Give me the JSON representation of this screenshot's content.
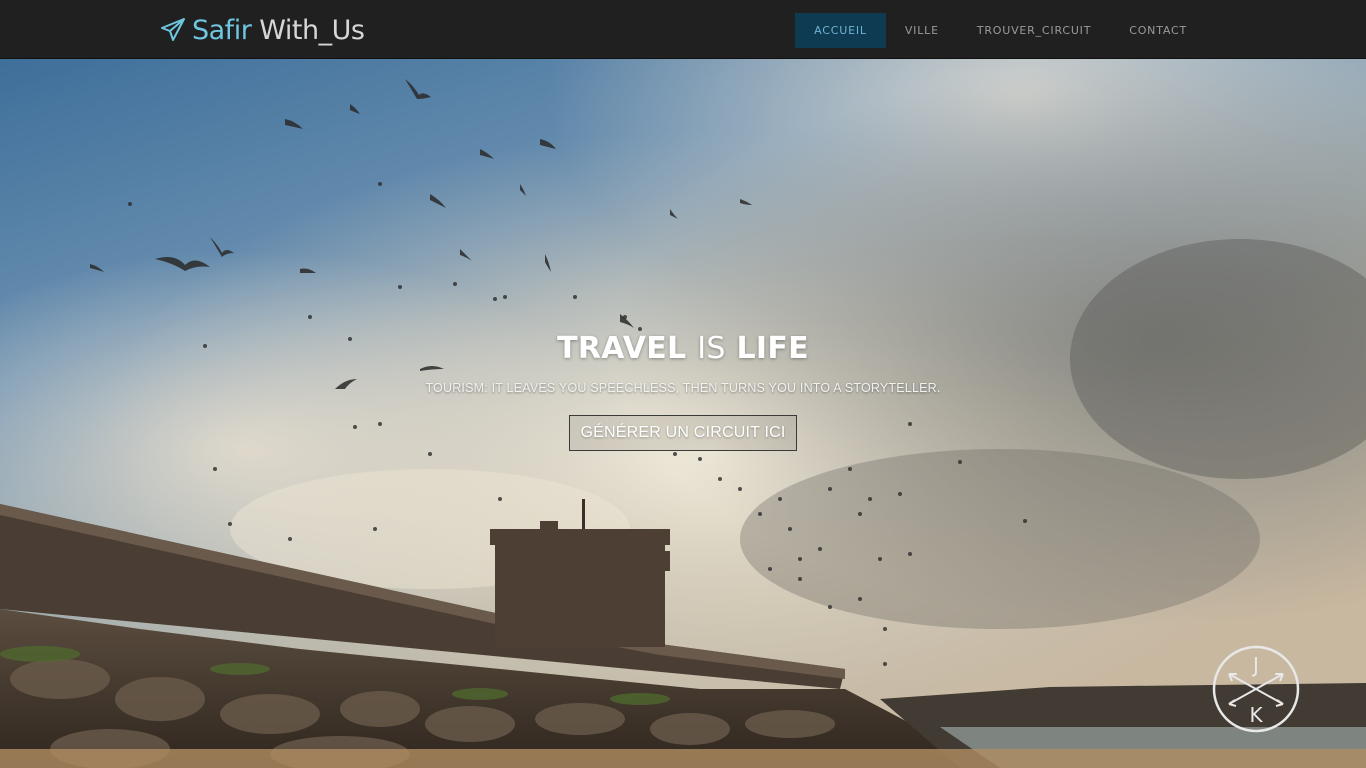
{
  "navbar": {
    "brand": {
      "part1": "Safir",
      "part2": "With_Us",
      "icon": "paper-plane-icon"
    },
    "links": [
      {
        "label": "ACCUEIL",
        "active": true
      },
      {
        "label": "VILLE",
        "active": false
      },
      {
        "label": "TROUVER_CIRCUIT",
        "active": false
      },
      {
        "label": "CONTACT",
        "active": false
      }
    ]
  },
  "hero": {
    "title_word1": "TRAVEL",
    "title_word2": "IS",
    "title_word3": "LIFE",
    "subtitle": "TOURISM: IT LEAVES YOU SPEECHLESS, THEN TURNS YOU INTO A STORYTELLER.",
    "cta_label": "GÉNÉRER UN CIRCUIT ICI"
  },
  "watermark": {
    "letter_top": "J",
    "letter_bottom": "K"
  },
  "colors": {
    "navbar_bg": "#202020",
    "brand_accent": "#6fc6e0",
    "active_tab_bg": "#0e3b52",
    "active_tab_text": "#6fb2d2"
  }
}
